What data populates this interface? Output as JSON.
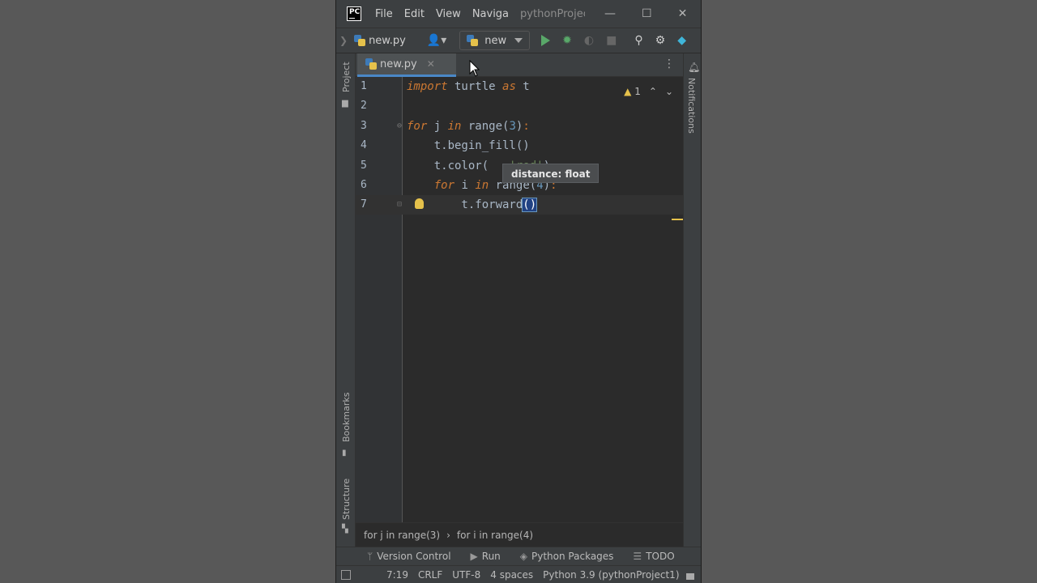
{
  "titlebar": {
    "menu": [
      "File",
      "Edit",
      "View",
      "Naviga"
    ],
    "project_title": "pythonProjec",
    "minimize": "—",
    "maximize": "☐",
    "close": "✕"
  },
  "toolbar": {
    "file": "new.py",
    "run_config": "new"
  },
  "stripes": {
    "project": "Project",
    "bookmarks": "Bookmarks",
    "structure": "Structure",
    "notifications": "Notifications"
  },
  "tabs": [
    {
      "label": "new.py",
      "active": true
    }
  ],
  "editor": {
    "warning_count": "1",
    "tooltip": "distance: float",
    "current_line": 7,
    "lines": [
      {
        "n": "1"
      },
      {
        "n": "2"
      },
      {
        "n": "3"
      },
      {
        "n": "4"
      },
      {
        "n": "5"
      },
      {
        "n": "6"
      },
      {
        "n": "7"
      }
    ],
    "tokens": {
      "l1_import": "import",
      "l1_mod": " turtle ",
      "l1_as": "as",
      "l1_alias": " t",
      "l3_for": "for",
      "l3_j": " j ",
      "l3_in": "in",
      "l3_range": " range(",
      "l3_num": "3",
      "l3_close": ")",
      "l3_colon": ":",
      "l4_code": "    t.begin_fill()",
      "l5_code": "    t.color(",
      "l5_str": "   'red'",
      "l5_close": ")",
      "l6_for": "for",
      "l6_i": " i ",
      "l6_in": "in",
      "l6_range": " range(",
      "l6_num": "4",
      "l6_close": ")",
      "l6_colon": ":",
      "l7_code": "        t.forward",
      "l7_paren_open": "(",
      "l7_paren_close": ")"
    }
  },
  "breadcrumb": [
    "for j in range(3)",
    "for i in range(4)"
  ],
  "bottom_tools": [
    {
      "icon": "version-control-icon",
      "label": "Version Control"
    },
    {
      "icon": "run-icon",
      "label": "Run"
    },
    {
      "icon": "packages-icon",
      "label": "Python Packages"
    },
    {
      "icon": "todo-icon",
      "label": "TODO"
    }
  ],
  "status": {
    "position": "7:19",
    "line_sep": "CRLF",
    "encoding": "UTF-8",
    "indent": "4 spaces",
    "interpreter": "Python 3.9 (pythonProject1)"
  },
  "colors": {
    "keyword": "#cc7832",
    "number": "#6897bb",
    "string": "#6a8759",
    "text": "#a9b7c6",
    "background": "#2b2b2b"
  }
}
